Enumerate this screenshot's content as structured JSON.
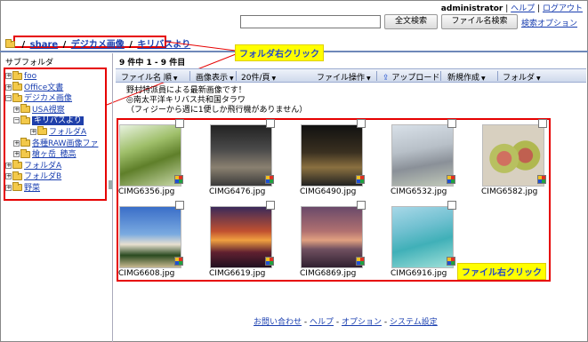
{
  "header": {
    "user": "administrator",
    "help": "ヘルプ",
    "logout": "ログアウト",
    "separator": "|",
    "search_value": "",
    "fulltext_button": "全文検索",
    "filename_button": "ファイル名検索",
    "search_option": "検索オプション"
  },
  "breadcrumb": {
    "root": "/",
    "items": [
      "share",
      "デジカメ画像",
      "キリバスより"
    ],
    "sep": "/"
  },
  "callouts": {
    "folder": "フォルダ右クリック",
    "file": "ファイル右クリック"
  },
  "sidebar": {
    "title": "サブフォルダ",
    "items": [
      {
        "label": "foo",
        "exp": "+"
      },
      {
        "label": "Office文書",
        "exp": "+"
      },
      {
        "label": "デジカメ画像",
        "exp": "−"
      },
      {
        "label": "USA視察",
        "exp": "+"
      },
      {
        "label": "キリバスより",
        "exp": "−"
      },
      {
        "label": "フォルダA",
        "exp": "+"
      },
      {
        "label": "各種RAW画像ファ",
        "exp": "+"
      },
      {
        "label": "槍ヶ岳_穂高",
        "exp": "+"
      },
      {
        "label": "フォルダA",
        "exp": "+"
      },
      {
        "label": "フォルダB",
        "exp": "+"
      },
      {
        "label": "野菜",
        "exp": "+"
      }
    ]
  },
  "main": {
    "count_prefix": "9 件中 ",
    "count_range": "1 - 9",
    "count_suffix": " 件目",
    "toolbar": {
      "sort": "ファイル名 順",
      "view": "画像表示",
      "per_page": "20件/頁",
      "file_ops": "ファイル操作",
      "upload": "アップロード",
      "new": "新規作成",
      "folder": "フォルダ"
    },
    "description": [
      "野村特派員による最新画像です！",
      "◎南太平洋キリバス共和国タラワ",
      "（フィジーから週に1便しか飛行機がありません）"
    ],
    "files": [
      {
        "name": "CIMG6356.jpg"
      },
      {
        "name": "CIMG6476.jpg"
      },
      {
        "name": "CIMG6490.jpg"
      },
      {
        "name": "CIMG6532.jpg"
      },
      {
        "name": "CIMG6582.jpg"
      },
      {
        "name": "CIMG6608.jpg"
      },
      {
        "name": "CIMG6619.jpg"
      },
      {
        "name": "CIMG6869.jpg"
      },
      {
        "name": "CIMG6916.jpg"
      }
    ]
  },
  "footer": {
    "contact": "お問い合わせ",
    "help": "ヘルプ",
    "option": "オプション",
    "settings": "システム設定",
    "sep": " - "
  }
}
